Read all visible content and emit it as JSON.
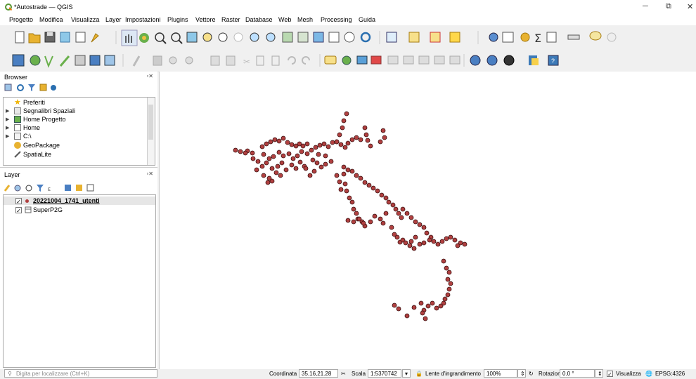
{
  "window": {
    "title": "*Autostrade — QGIS",
    "minimize": "─",
    "restore": "⧉",
    "close": "✕"
  },
  "menu": [
    "Progetto",
    "Modifica",
    "Visualizza",
    "Layer",
    "Impostazioni",
    "Plugins",
    "Vettore",
    "Raster",
    "Database",
    "Web",
    "Mesh",
    "Processing",
    "Guida"
  ],
  "browser": {
    "title": "Browser",
    "items": [
      "Preferiti",
      "Segnalibri Spaziali",
      "Home Progetto",
      "Home",
      "C:\\",
      "GeoPackage",
      "SpatiaLite"
    ]
  },
  "layers": {
    "title": "Layer",
    "items": [
      {
        "name": "20221004_1741_utenti",
        "checked": "✓"
      },
      {
        "name": "SuperP2G",
        "checked": "✓"
      }
    ]
  },
  "status": {
    "search_placeholder": "Digita per localizzare (Ctrl+K)",
    "coord_label": "Coordinata",
    "coord_value": "35.16,21.28",
    "scale_label": "Scala",
    "scale_value": "1:5370742",
    "magnifier_label": "Lente d'ingrandimento",
    "magnifier_value": "100%",
    "rotation_label": "Rotazione",
    "rotation_value": "0.0 °",
    "render_label": "Visualizza",
    "crs": "EPSG:4326"
  },
  "colors": {
    "point_fill": "#b04040",
    "point_stroke": "#3a1010",
    "accent": "#589632"
  }
}
